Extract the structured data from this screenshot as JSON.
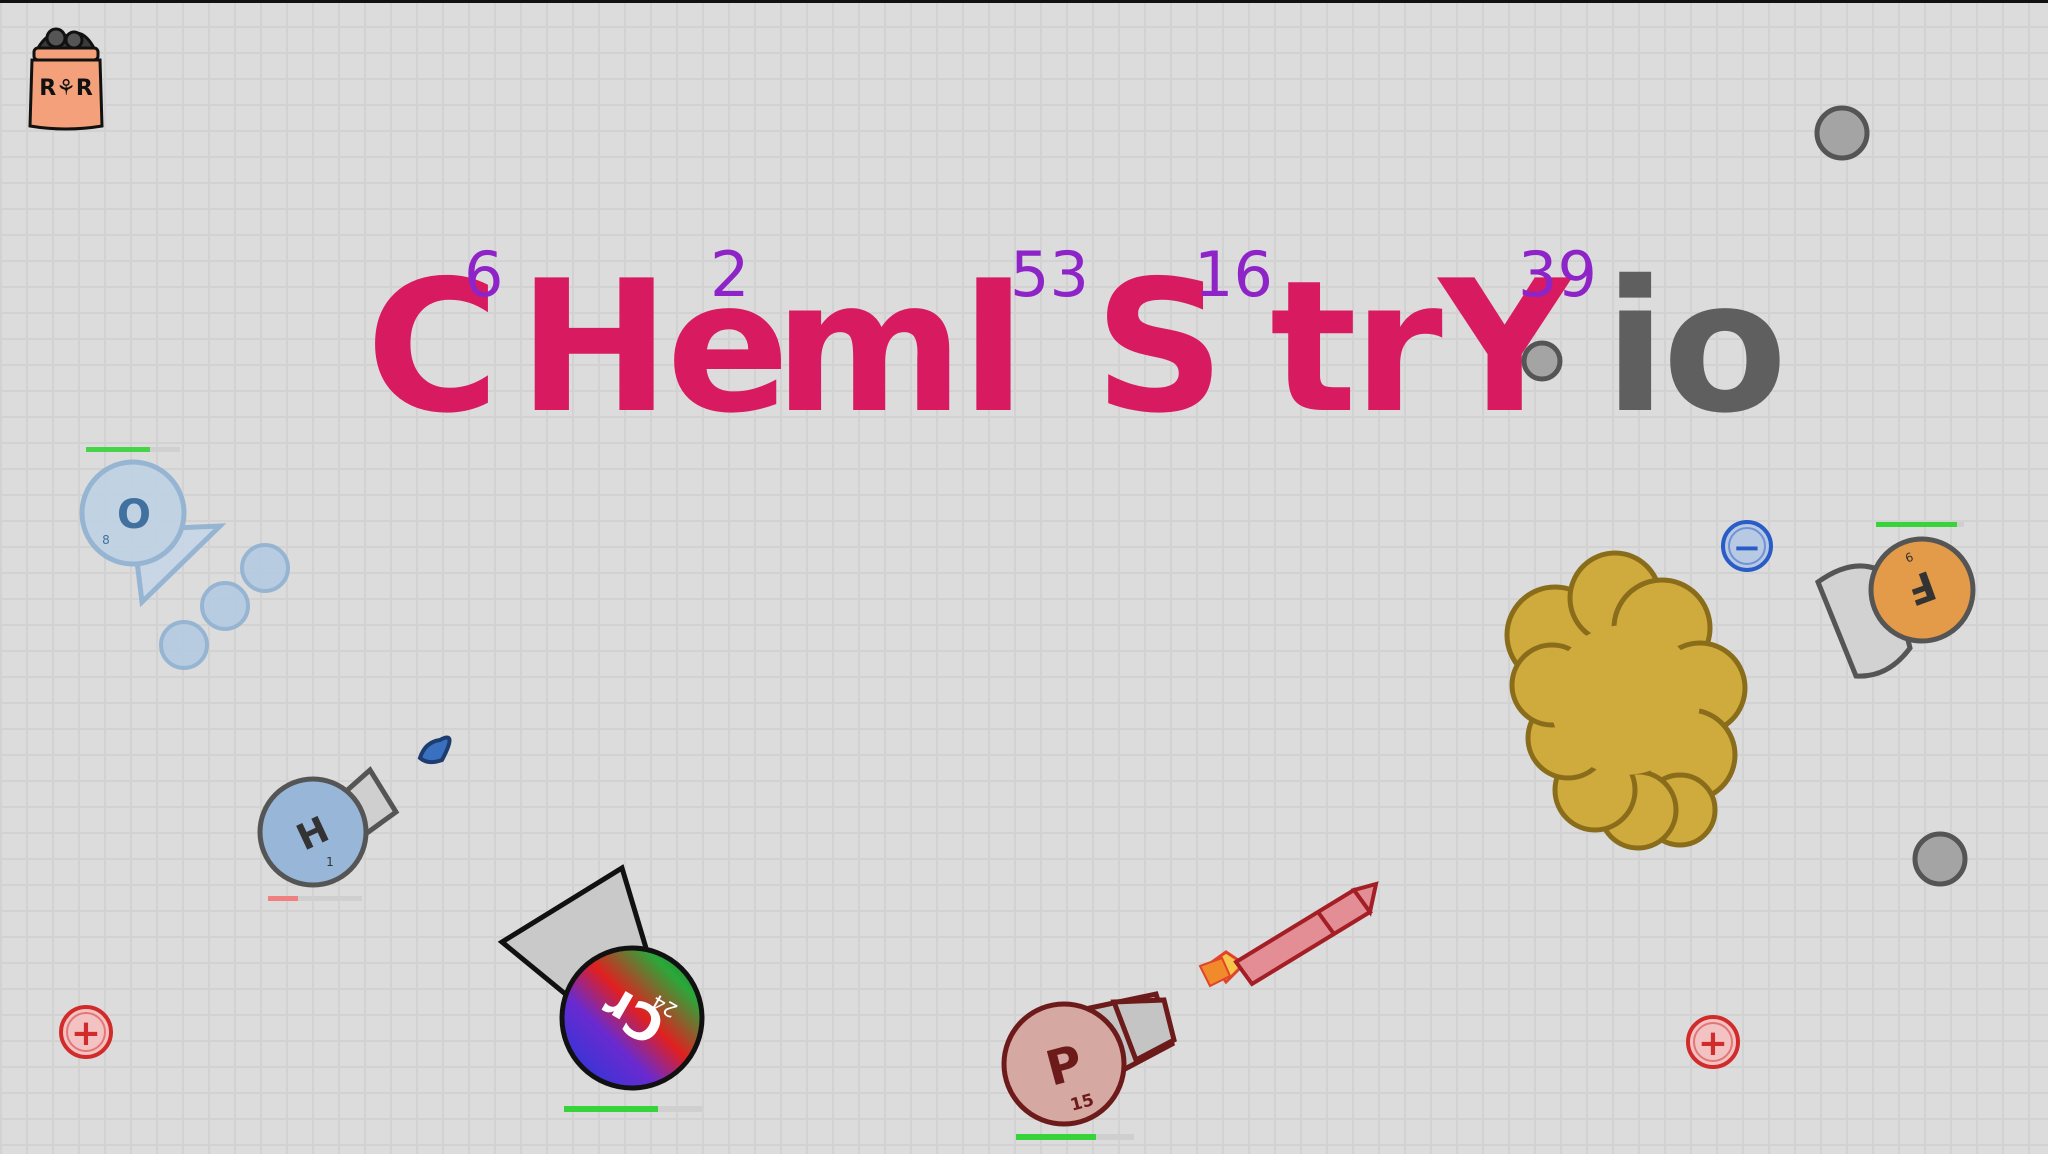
{
  "logo": {
    "text": "R⚘R",
    "icon": "seed-bag-icon"
  },
  "title": {
    "elements": [
      {
        "symbol": "C",
        "number": "6"
      },
      {
        "symbol": "He",
        "number": "2"
      },
      {
        "symbol": "mI",
        "number": "53"
      },
      {
        "symbol": "S",
        "number": "16"
      },
      {
        "symbol": "trY",
        "number": "39"
      }
    ],
    "suffix": "io"
  },
  "players": {
    "oxygen": {
      "symbol": "O",
      "number": "8",
      "health": 0.68
    },
    "hydrogen": {
      "symbol": "H",
      "number": "1",
      "health": 0.32
    },
    "chromium": {
      "symbol": "Cr",
      "number": "24",
      "health": 0.68
    },
    "phosphorus": {
      "symbol": "P",
      "number": "15",
      "health": 0.68
    },
    "fluorine": {
      "symbol": "F",
      "number": "9",
      "health": 0.92
    }
  },
  "pickups": {
    "positive": "+",
    "negative": "−"
  },
  "colors": {
    "title": "#d81b60",
    "numbers": "#8e24c8",
    "health": "#36d43a",
    "health_low": "#f08080"
  }
}
